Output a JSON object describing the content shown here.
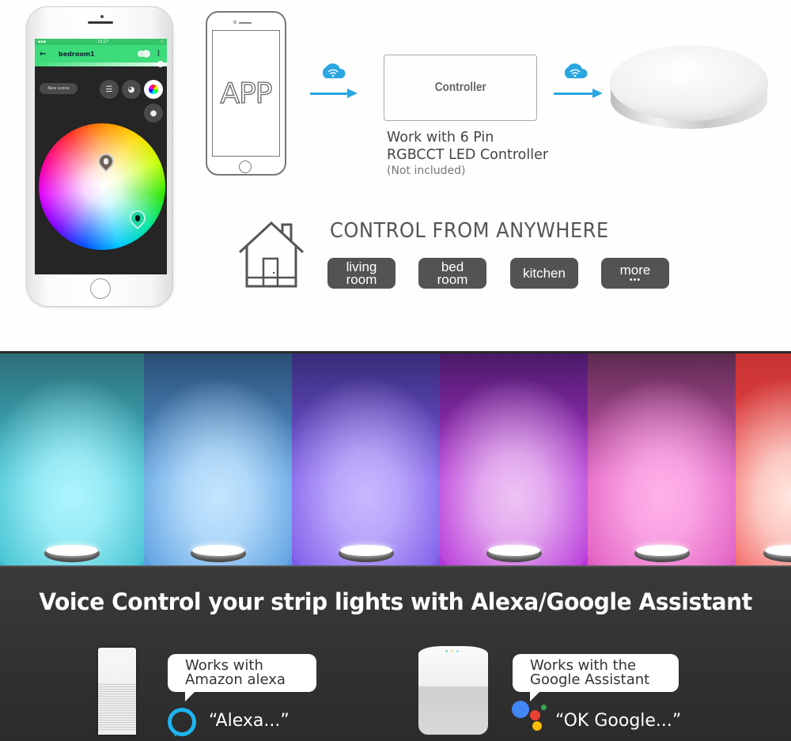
{
  "app_phone": {
    "screen_title": "bedroom1",
    "status_time": "15:27",
    "new_scene_label": "New scene",
    "icons": [
      "back-arrow-icon",
      "power-toggle-icon",
      "more-vertical-icon",
      "list-icon",
      "palette-icon",
      "color-wheel-icon",
      "light-pin-icon"
    ],
    "accent_color": "#3ddc7a"
  },
  "outline_phone": {
    "label": "APP"
  },
  "controller": {
    "box_label": "Controller",
    "note_line1": "Work with 6 Pin",
    "note_line2": "RGBCCT LED Controller",
    "note_line3": "(Not included)"
  },
  "cloud_wifi_color": "#2aa6e0",
  "control_anywhere": {
    "title": "CONTROL FROM ANYWHERE",
    "rooms": [
      {
        "line1": "living",
        "line2": "room"
      },
      {
        "line1": "bed",
        "line2": "room"
      },
      {
        "line1": "kitchen",
        "line2": ""
      },
      {
        "line1": "more",
        "line2": "•••"
      }
    ]
  },
  "color_panels": [
    {
      "name": "cyan",
      "top": "#2d6e78",
      "glow": "#aef6ff",
      "mid": "#3fc0cf"
    },
    {
      "name": "sky-blue",
      "top": "#2a4e74",
      "glow": "#c4e6ff",
      "mid": "#5a9ee0"
    },
    {
      "name": "violet",
      "top": "#372c78",
      "glow": "#c9b8ff",
      "mid": "#7b5ae8"
    },
    {
      "name": "purple",
      "top": "#4a1a68",
      "glow": "#eec4f4",
      "mid": "#b534d8"
    },
    {
      "name": "pink",
      "top": "#5a2a4e",
      "glow": "#ffb2ea",
      "mid": "#e05cc0"
    },
    {
      "name": "red",
      "top": "#c83232",
      "glow": "#ffe8e0",
      "mid": "#f04848"
    }
  ],
  "voice": {
    "title": "Voice Control your strip lights with Alexa/Google Assistant",
    "alexa": {
      "bubble_line1": "Works with",
      "bubble_line2": "Amazon alexa",
      "phrase": "“Alexa...”",
      "brand_color": "#1eb4ef"
    },
    "google": {
      "bubble_line1": "Works with the",
      "bubble_line2": "Google Assistant",
      "phrase": "“OK Google...”",
      "dot_colors": [
        "#4285f4",
        "#ea4335",
        "#fbbc05",
        "#34a853"
      ]
    }
  }
}
